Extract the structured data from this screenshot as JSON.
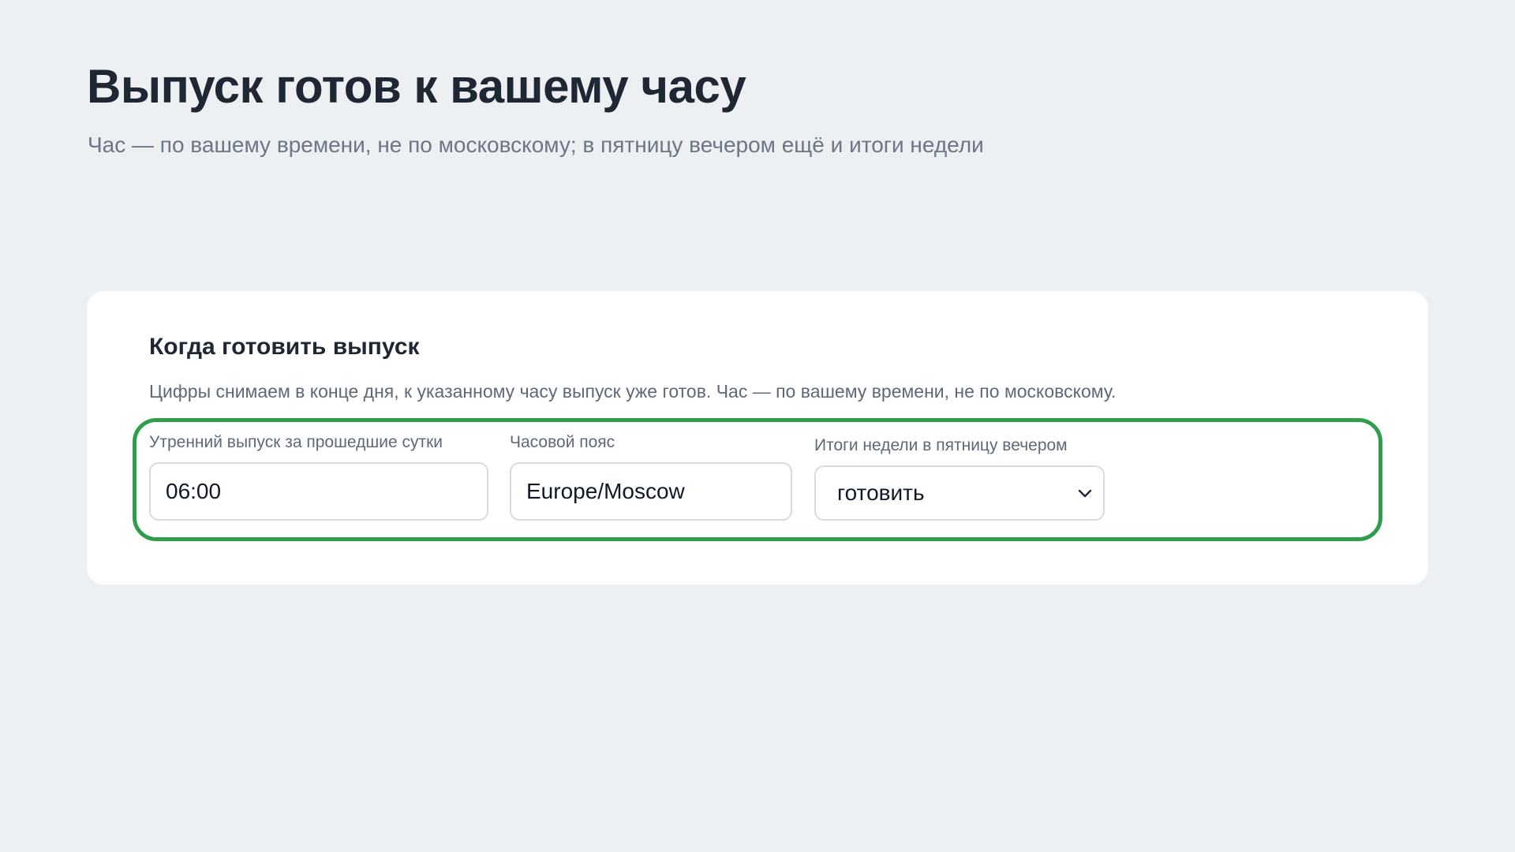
{
  "header": {
    "title": "Выпуск готов к вашему часу",
    "subtitle": "Час — по вашему времени, не по московскому; в пятницу вечером ещё и итоги недели"
  },
  "card": {
    "title": "Когда готовить выпуск",
    "description": "Цифры снимаем в конце дня, к указанному часу выпуск уже готов. Час — по вашему времени, не по московскому."
  },
  "fields": {
    "morning": {
      "label": "Утренний выпуск за прошедшие сутки",
      "value": "06:00"
    },
    "timezone": {
      "label": "Часовой пояс",
      "value": "Europe/Moscow"
    },
    "weekly": {
      "label": "Итоги недели в пятницу вечером",
      "selected": "готовить"
    }
  },
  "colors": {
    "background": "#edf0f3",
    "card": "#ffffff",
    "highlight": "#2e9e4d",
    "title": "#1e2733",
    "muted": "#6c7686"
  },
  "icons": {
    "select_arrow": "chevron-down-icon"
  }
}
